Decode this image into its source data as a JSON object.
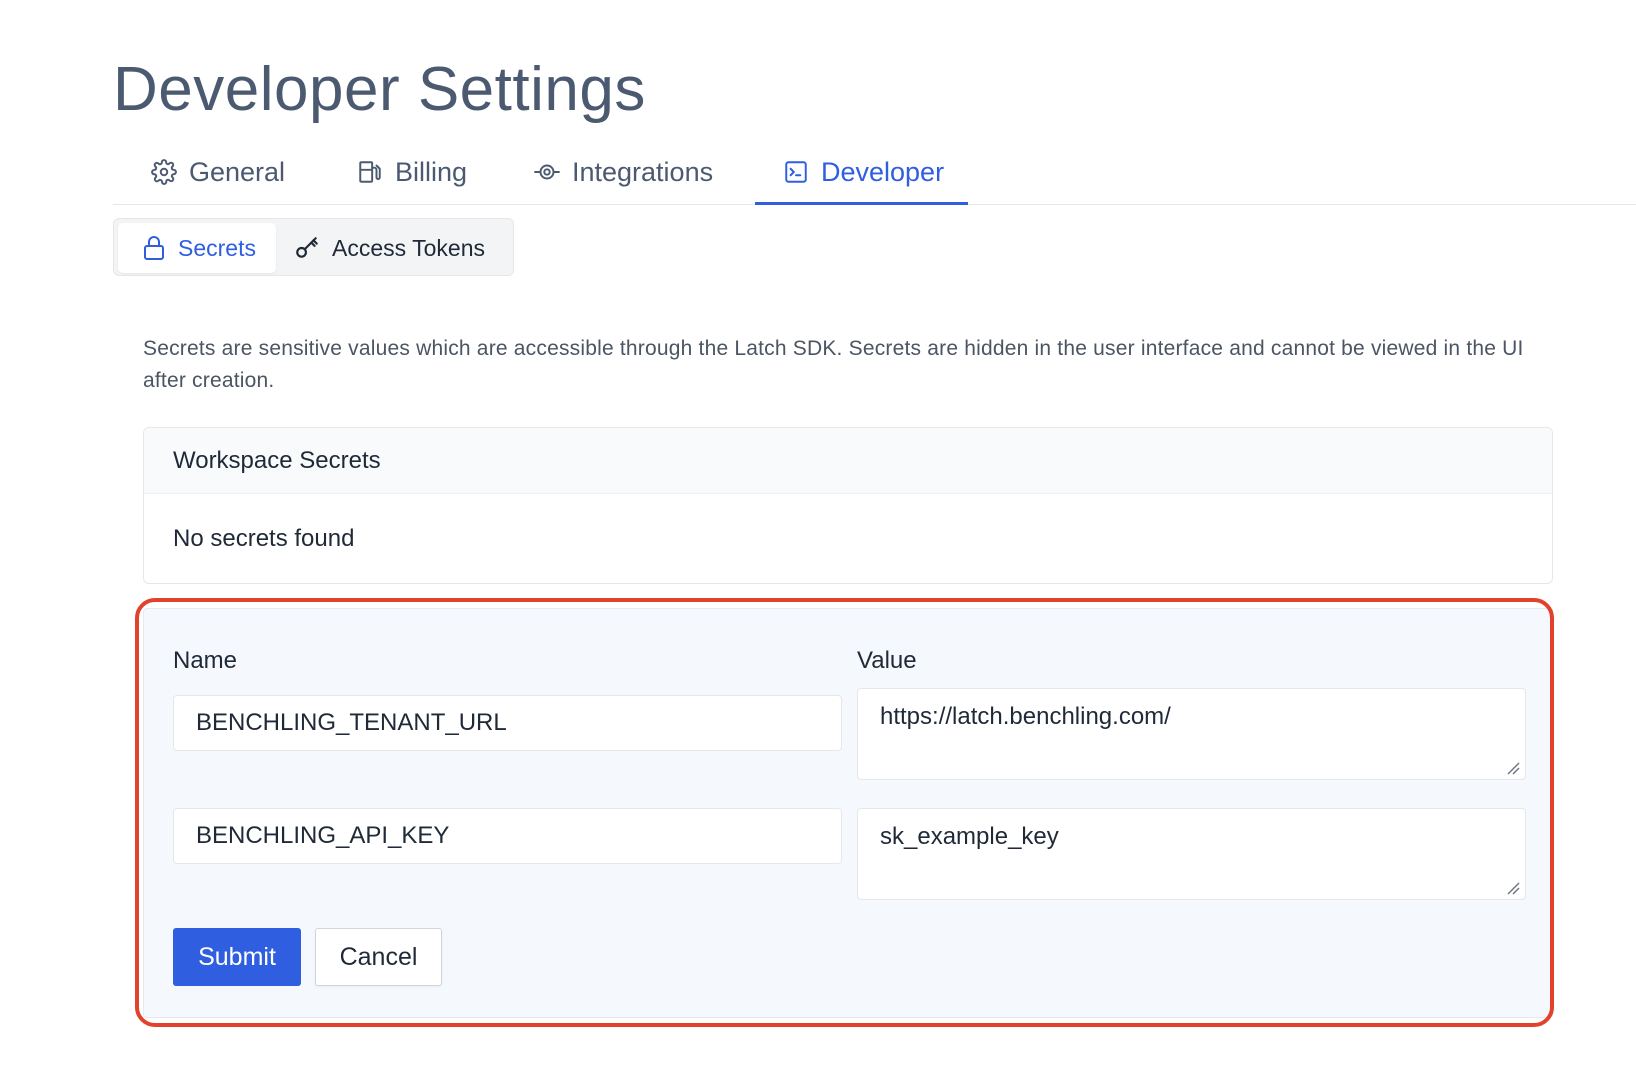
{
  "page": {
    "title": "Developer Settings"
  },
  "tabs": [
    {
      "label": "General",
      "icon": "gear-icon",
      "active": false
    },
    {
      "label": "Billing",
      "icon": "fuel-pump-icon",
      "active": false
    },
    {
      "label": "Integrations",
      "icon": "integrations-icon",
      "active": false
    },
    {
      "label": "Developer",
      "icon": "terminal-icon",
      "active": true
    }
  ],
  "subtabs": [
    {
      "label": "Secrets",
      "icon": "lock-icon",
      "active": true
    },
    {
      "label": "Access Tokens",
      "icon": "key-icon",
      "active": false
    }
  ],
  "description": "Secrets are sensitive values which are accessible through the Latch SDK. Secrets are hidden in the user interface and cannot be viewed in the UI after creation.",
  "secrets_card": {
    "header": "Workspace Secrets",
    "empty_text": "No secrets found"
  },
  "form": {
    "name_label": "Name",
    "value_label": "Value",
    "rows": [
      {
        "name": "BENCHLING_TENANT_URL",
        "value": "https://latch.benchling.com/"
      },
      {
        "name": "BENCHLING_API_KEY",
        "value": "sk_example_key"
      }
    ],
    "submit_label": "Submit",
    "cancel_label": "Cancel"
  },
  "colors": {
    "accent": "#2f5ee0",
    "highlight": "#e2412c",
    "title": "#4b5a70"
  }
}
